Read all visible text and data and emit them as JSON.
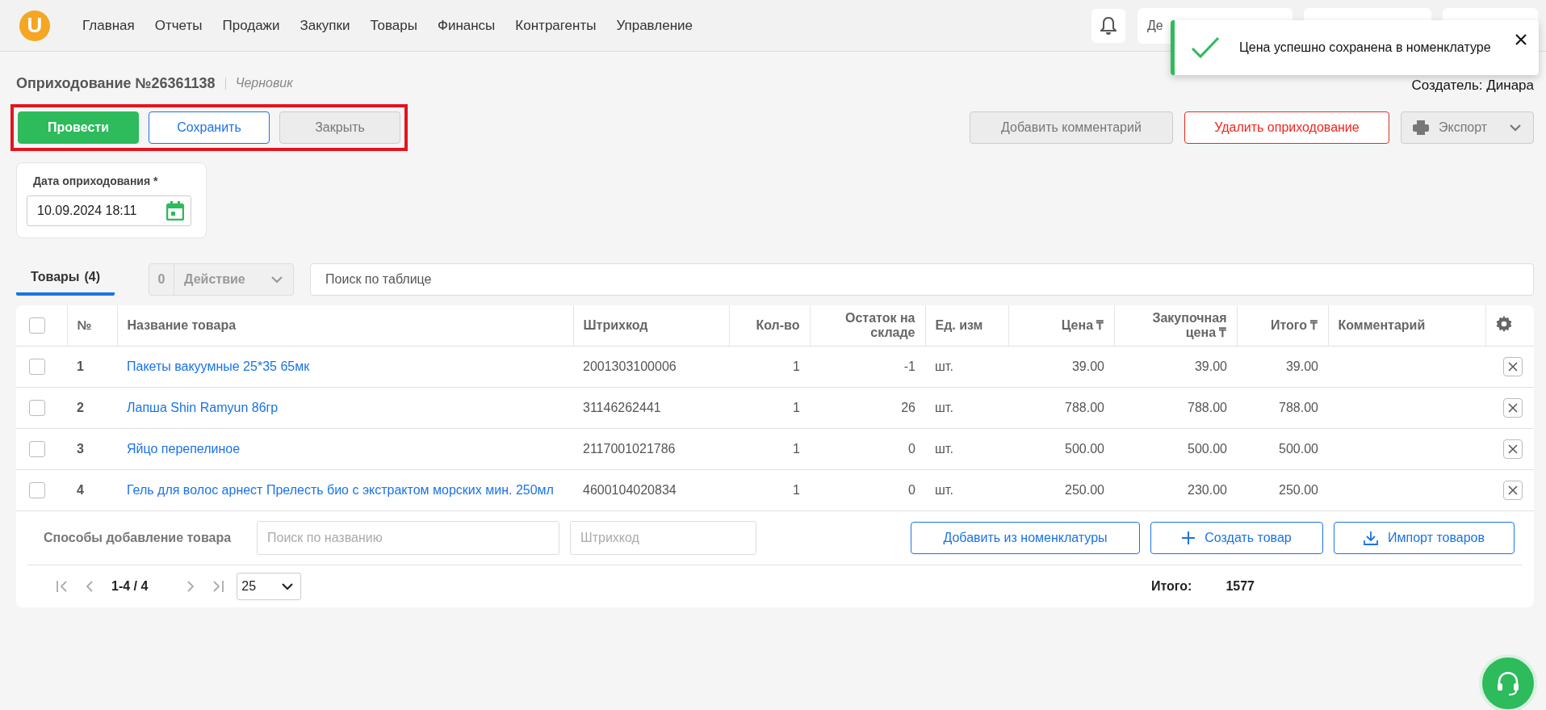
{
  "header": {
    "logo": "U",
    "nav": [
      {
        "label": "Главная"
      },
      {
        "label": "Отчеты"
      },
      {
        "label": "Продажи"
      },
      {
        "label": "Закупки"
      },
      {
        "label": "Товары"
      },
      {
        "label": "Финансы"
      },
      {
        "label": "Контрагенты"
      },
      {
        "label": "Управление"
      }
    ],
    "account_chip": {
      "label": "Де"
    }
  },
  "toast": {
    "message": "Цена успешно сохранена в номенклатуре"
  },
  "document": {
    "title": "Оприходование №26361138",
    "status": "Черновик",
    "creator": "Создатель: Динара"
  },
  "actions_left": [
    {
      "label": "Провести",
      "kind": "primary"
    },
    {
      "label": "Сохранить",
      "kind": "outline"
    },
    {
      "label": "Закрыть",
      "kind": "secondary"
    }
  ],
  "actions_right": [
    {
      "label": "Добавить комментарий",
      "kind": "secondary"
    },
    {
      "label": "Удалить оприходование",
      "kind": "danger"
    },
    {
      "label": "Экспорт",
      "kind": "export"
    }
  ],
  "date_field": {
    "label": "Дата оприходования *",
    "value": "10.09.2024 18:11"
  },
  "tabs": [
    {
      "label": "Товары",
      "count": "(4)",
      "selected": true
    }
  ],
  "bulk_action": {
    "count": "0",
    "label": "Действие",
    "disabled": true
  },
  "table_search": {
    "placeholder": "Поиск по таблице"
  },
  "table": {
    "select_all": {
      "checked": false
    },
    "columns": [
      "№",
      "Название товара",
      "Штрихкод",
      "Кол-во",
      "Остаток на складе",
      "Ед. изм",
      "Цена ₸",
      "Закупочная цена ₸",
      "Итого ₸",
      "Комментарий"
    ],
    "rows": [
      {
        "checked": false,
        "cells": [
          "1",
          "Пакеты вакуумные 25*35 65мк",
          "2001303100006",
          "1",
          "-1",
          "шт.",
          "39.00",
          "39.00",
          "39.00"
        ]
      },
      {
        "checked": false,
        "cells": [
          "2",
          "Лапша Shin Ramyun 86гр",
          "31146262441",
          "1",
          "26",
          "шт.",
          "788.00",
          "788.00",
          "788.00"
        ]
      },
      {
        "checked": false,
        "cells": [
          "3",
          "Яйцо перепелиное",
          "2117001021786",
          "1",
          "0",
          "шт.",
          "500.00",
          "500.00",
          "500.00"
        ]
      },
      {
        "checked": false,
        "cells": [
          "4",
          "Гель для волос арнест Прелесть био с экстрактом морских мин. 250мл",
          "4600104020834",
          "1",
          "0",
          "шт.",
          "250.00",
          "230.00",
          "250.00"
        ]
      }
    ]
  },
  "add_panel": {
    "label": "Способы добавление товара",
    "name_search": {
      "placeholder": "Поиск по названию"
    },
    "barcode": {
      "placeholder": "Штрихкод"
    },
    "buttons": [
      {
        "label": "Добавить из номенклатуры",
        "kind": "plain"
      },
      {
        "label": "Создать товар",
        "kind": "create"
      },
      {
        "label": "Импорт товаров",
        "kind": "import"
      }
    ]
  },
  "pagination": {
    "range": "1-4 / 4",
    "page_size": "25"
  },
  "total": {
    "label": "Итого:",
    "value": "1577"
  }
}
